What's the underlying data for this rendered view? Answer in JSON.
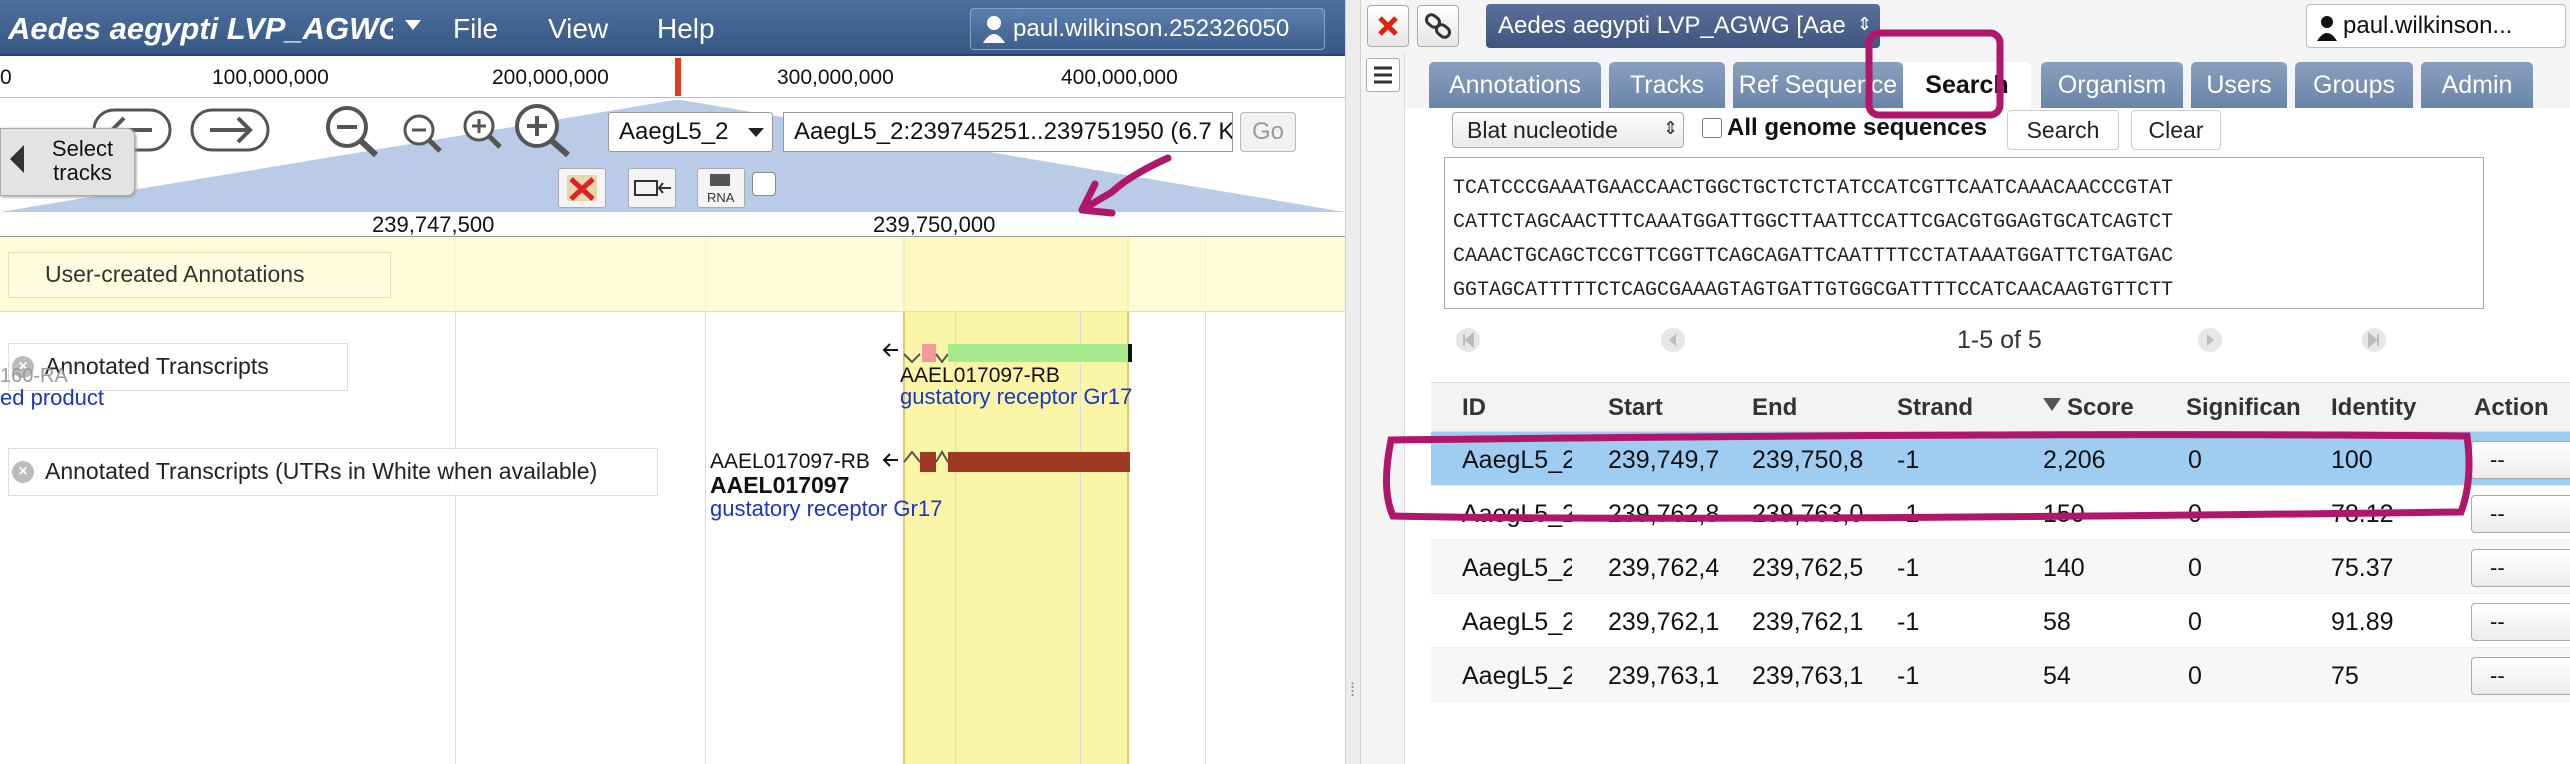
{
  "browser": {
    "organism_title": "Aedes aegypti LVP_AGWG [",
    "menu": [
      "File",
      "View",
      "Help"
    ],
    "user": "paul.wilkinson.252326050",
    "overview_ticks": [
      "0",
      "100,000,000",
      "200,000,000",
      "300,000,000",
      "400,000,000"
    ],
    "select_tracks_label": "Select tracks",
    "ref_sequence": "AaegL5_2",
    "location": "AaegL5_2:239745251..239751950 (6.7 K",
    "go_label": "Go",
    "scale_ticks": [
      "239,747,500",
      "239,750,000"
    ],
    "tracks": {
      "user_created": "User-created Annotations",
      "annotated_transcripts": "Annotated Transcripts",
      "annotated_transcripts_utr": "Annotated Transcripts (UTRs in White when available)"
    },
    "features": {
      "left_partial_id": "160-RA",
      "left_partial_desc": "ed product",
      "rb_id": "AAEL017097-RB",
      "rb_desc": "gustatory receptor Gr17",
      "rb2_id": "AAEL017097-RB",
      "gene_id": "AAEL017097",
      "gene_desc": "gustatory receptor Gr17"
    }
  },
  "panel": {
    "organism": "Aedes aegypti LVP_AGWG [Aae",
    "user": "paul.wilkinson...",
    "tabs": [
      "Annotations",
      "Tracks",
      "Ref Sequence",
      "Search",
      "Organism",
      "Users",
      "Groups",
      "Admin"
    ],
    "active_tab": "Search",
    "search": {
      "method": "Blat nucleotide",
      "all_genome_label": "All genome sequences",
      "search_button": "Search",
      "clear_button": "Clear",
      "sequence_lines": [
        "TCATCCCGAAATGAACCAACTGGCTGCTCTCTATCCATCGTTCAATCAAACAACCCGTAT",
        "CATTCTAGCAACTTTCAAATGGATTGGCTTAATTCCATTCGACGTGGAGTGCATCAGTCT",
        "CAAACTGCAGCTCCGTTCGGTTCAGCAGATTCAATTTTCCTATAAATGGATTCTGATGAC",
        "GGTAGCATTTTTCTCAGCGAAAGTAGTGATTGTGGCGATTTTCCATCAACAAGTGTTCTT"
      ]
    },
    "pager_text": "1-5 of 5",
    "columns": [
      "ID",
      "Start",
      "End",
      "Strand",
      "Score",
      "Significan",
      "Identity",
      "Action"
    ],
    "rows": [
      {
        "id": "AaegL5_2",
        "start": "239,749,7",
        "end": "239,750,8",
        "strand": "-1",
        "score": "2,206",
        "sig": "0",
        "identity": "100",
        "action": "--"
      },
      {
        "id": "AaegL5_2",
        "start": "239,762,8",
        "end": "239,763,0",
        "strand": "-1",
        "score": "150",
        "sig": "0",
        "identity": "78.12",
        "action": "--"
      },
      {
        "id": "AaegL5_2",
        "start": "239,762,4",
        "end": "239,762,5",
        "strand": "-1",
        "score": "140",
        "sig": "0",
        "identity": "75.37",
        "action": "--"
      },
      {
        "id": "AaegL5_2",
        "start": "239,762,1",
        "end": "239,762,1",
        "strand": "-1",
        "score": "58",
        "sig": "0",
        "identity": "91.89",
        "action": "--"
      },
      {
        "id": "AaegL5_2",
        "start": "239,763,1",
        "end": "239,763,1",
        "strand": "-1",
        "score": "54",
        "sig": "0",
        "identity": "75",
        "action": "--"
      }
    ]
  },
  "colors": {
    "highlight": "#fbf5a8",
    "selected_row": "#9fcdf2",
    "annotation_marker": "#b0176a",
    "feature_green": "#a6eb8c",
    "feature_brown": "#9e3a22"
  }
}
